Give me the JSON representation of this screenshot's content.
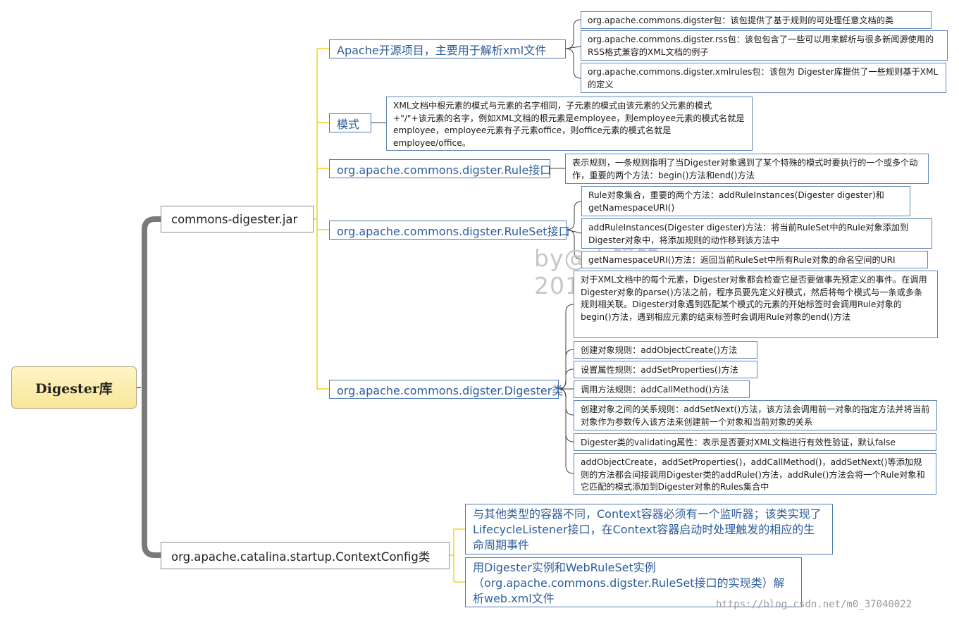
{
  "root": {
    "label": "Digester库"
  },
  "branches": {
    "jar": {
      "label": "commons-digester.jar",
      "apache": {
        "label": "Apache开源项目，主要用于解析xml文件",
        "items": [
          "org.apache.commons.digster包：该包提供了基于规则的可处理任意文档的类",
          "org.apache.commons.digster.rss包：该包包含了一些可以用来解析与很多新闻源使用的RSS格式兼容的XML文档的例子",
          "org.apache.commons.digster.xmlrules包：该包为 Digester库提供了一些规则基于XML的定义"
        ]
      },
      "pattern": {
        "label": "模式",
        "items": [
          "XML文档中根元素的模式与元素的名字相同，子元素的模式由该元素的父元素的模式+\"/\"+该元素的名字，例如XML文档的根元素是employee，则employee元素的模式名就是employee，employee元素有子元素office，则office元素的模式名就是employee/office。"
        ]
      },
      "rule": {
        "label": "org.apache.commons.digster.Rule接口",
        "items": [
          "表示规则，一条规则指明了当Digester对象遇到了某个特殊的模式时要执行的一个或多个动作，重要的两个方法：begin()方法和end()方法"
        ]
      },
      "ruleset": {
        "label": "org.apache.commons.digster.RuleSet接口",
        "items": [
          "Rule对象集合，重要的两个方法：addRuleInstances(Digester digester)和getNamespaceURI()",
          "addRuleInstances(Digester digester)方法：将当前RuleSet中的Rule对象添加到Digester对象中，将添加规则的动作移到该方法中",
          "getNamespaceURI()方法：返回当前RuleSet中所有Rule对象的命名空间的URI"
        ]
      },
      "digester": {
        "label": "org.apache.commons.digster.Digester类",
        "items": [
          "对于XML文档中的每个元素，Digester对象都会检查它是否要做事先预定义的事件。在调用Digester对象的parse()方法之前，程序员要先定义好模式，然后将每个模式与一条或多条规则相关联。Digester对象遇到匹配某个模式的元素的开始标签时会调用Rule对象的begin()方法，遇到相应元素的结束标签时会调用Rule对象的end()方法",
          "创建对象规则：addObjectCreate()方法",
          "设置属性规则：addSetProperties()方法",
          "调用方法规则：addCallMethod()方法",
          "创建对象之间的关系规则：addSetNext()方法，该方法会调用前一对象的指定方法并将当前对象作为参数传入该方法来创建前一个对象和当前对象的关系",
          "Digester类的validating属性：表示是否要对XML文档进行有效性验证，默认false",
          "addObjectCreate，addSetProperties()，addCallMethod()，addSetNext()等添加规则的方法都会间接调用Digester类的addRule()方法，addRule()方法会将一个Rule对象和它匹配的模式添加到Digester对象的Rules集合中"
        ]
      }
    },
    "contextconfig": {
      "label": "org.apache.catalina.startup.ContextConfig类",
      "items": [
        "与其他类型的容器不同，Context容器必须有一个监听器；该类实现了LifecycleListener接口，在Context容器启动时处理触发的相应的生命周期事件",
        "用Digester实例和WebRuleSet实例（org.apache.commons.digster.RuleSet接口的实现类）解析web.xml文件"
      ]
    }
  },
  "watermark": {
    "line1": "by@中镜铭",
    "line2": "201"
  },
  "credit": "https://blog.csdn.net/m0_37040022",
  "colors": {
    "trunk": "#7a7a7a",
    "jar_links": "#f2d421",
    "leaf_links": "#404040",
    "contextconfig_links": "#f2d421",
    "node_text": "#2d5d9c"
  }
}
